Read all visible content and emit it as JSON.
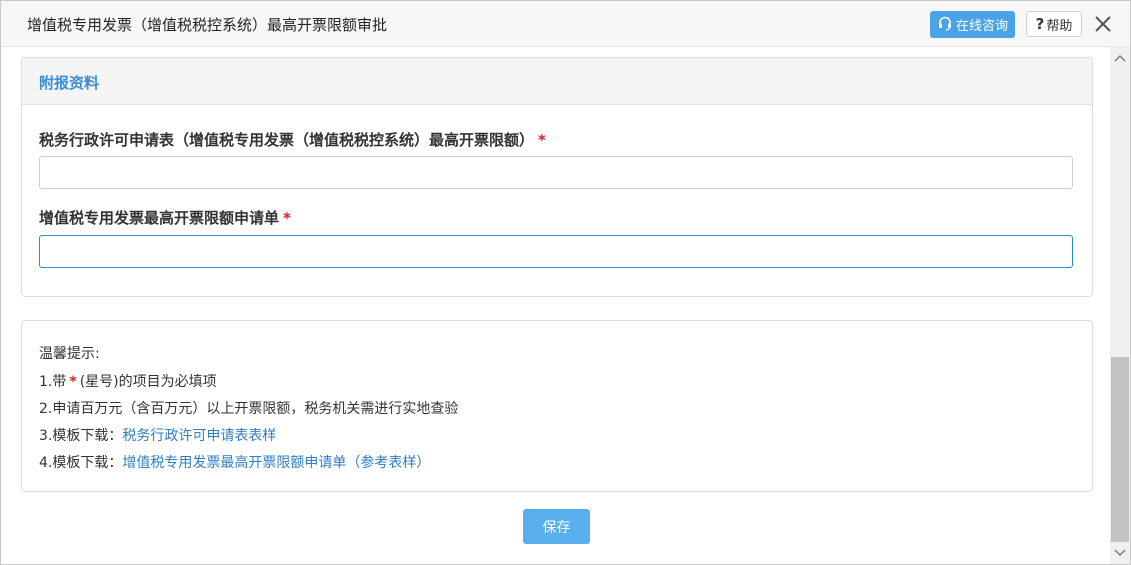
{
  "dialog": {
    "title": "增值税专用发票（增值税税控系统）最高开票限额审批",
    "consult_label": "在线咨询",
    "help_q": "?",
    "help_label": "帮助"
  },
  "panel": {
    "title": "附报资料",
    "fields": [
      {
        "label": "税务行政许可申请表（增值税专用发票（增值税税控系统）最高开票限额）",
        "required": "*",
        "value": ""
      },
      {
        "label": "增值税专用发票最高开票限额申请单",
        "required": "*",
        "value": ""
      }
    ]
  },
  "tips": {
    "heading": "温馨提示:",
    "line1_prefix": "1.带",
    "line1_star": "*",
    "line1_suffix": "(星号)的项目为必填项",
    "line2": "2.申请百万元（含百万元）以上开票限额，税务机关需进行实地查验",
    "line3_prefix": "3.模板下载：",
    "line3_link": "税务行政许可申请表表样",
    "line4_prefix": "4.模板下载：",
    "line4_link": "增值税专用发票最高开票限额申请单（参考表样）"
  },
  "actions": {
    "save_label": "保存"
  },
  "icons": {
    "consult": "headset-icon",
    "close": "close-icon",
    "scroll_up": "chevron-up-icon",
    "scroll_down": "chevron-down-icon"
  },
  "colors": {
    "accent": "#4aa3e6",
    "link": "#2f7ec4",
    "required": "#e02020",
    "save": "#5ab0ee"
  }
}
